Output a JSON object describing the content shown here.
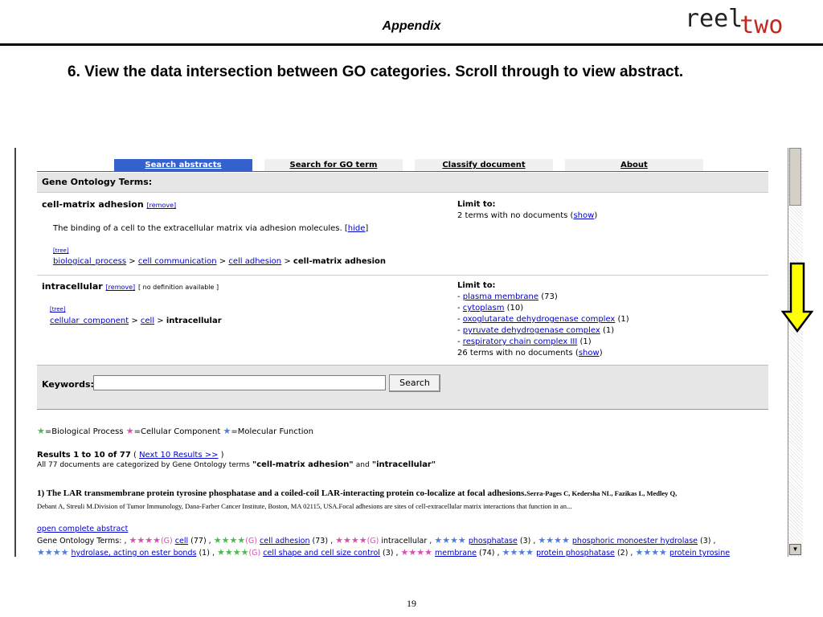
{
  "slide": {
    "title": "Appendix",
    "logo_reel": "reel",
    "logo_two": "two",
    "instruction": "6. View the data intersection between GO categories.  Scroll through to view abstract.",
    "page_number": "19"
  },
  "tabs": [
    {
      "label": "Search abstracts",
      "active": true
    },
    {
      "label": "Search for GO term",
      "active": false
    },
    {
      "label": "Classify document",
      "active": false
    },
    {
      "label": "About",
      "active": false
    }
  ],
  "panel": {
    "heading": "Gene Ontology Terms:",
    "term1": {
      "name": "cell-matrix adhesion",
      "remove": "[remove]",
      "definition_text": "The binding of a cell to the extracellular matrix via adhesion molecules. [",
      "hide": "hide",
      "definition_end": "]",
      "tree": "[tree]",
      "path": [
        "biological_process",
        "cell communication",
        "cell adhesion"
      ],
      "current": "cell-matrix adhesion",
      "limit_label": "Limit to:",
      "no_docs_text": "2 terms with no documents (",
      "show": "show",
      "no_docs_end": ")"
    },
    "term2": {
      "name": "intracellular",
      "remove": "[remove]",
      "no_def": "[ no definition available ]",
      "tree": "[tree]",
      "path": [
        "cellular_component",
        "cell"
      ],
      "current": "intracellular",
      "limit_label": "Limit to:",
      "limits": [
        {
          "label": "plasma membrane",
          "count": "(73)"
        },
        {
          "label": "cytoplasm",
          "count": "(10)"
        },
        {
          "label": "oxoglutarate dehydrogenase complex",
          "count": "(1)"
        },
        {
          "label": "pyruvate dehydrogenase complex",
          "count": "(1)"
        },
        {
          "label": "respiratory chain complex III",
          "count": "(1)"
        }
      ],
      "no_docs_text": "26 terms with no documents (",
      "show": "show",
      "no_docs_end": ")"
    }
  },
  "keywords": {
    "label": "Keywords:",
    "value": "",
    "button": "Search"
  },
  "legend": {
    "bio": "=Biological Process",
    "cell": "=Cellular Component",
    "mol": "=Molecular Function"
  },
  "results": {
    "summary": "Results 1 to 10 of 77",
    "next": "Next 10 Results >>",
    "categorized_prefix": "All 77 documents are categorized by Gene Ontology terms",
    "term_a": "\"cell-matrix adhesion\"",
    "and": "and",
    "term_b": "\"intracellular\"",
    "article_title": "1) The LAR transmembrane protein tyrosine phosphatase and a coiled-coil LAR-interacting protein co-localize at focal adhesions.",
    "article_authors": "Serra-Pages C, Kedersha NL, Fazikas L, Medley Q,",
    "article_meta": "Debant A, Streuli M.Division of Tumor Immunology, Dana-Farber Cancer Institute, Boston, MA 02115, USA.Focal adhesions are sites of cell-extracellular matrix interactions that function in an...",
    "open_abstract": "open complete abstract",
    "go_prefix": "Gene Ontology Terms: ,",
    "go_terms_line1": [
      {
        "label": "cell",
        "count": "(77) ,",
        "type": "cell"
      },
      {
        "label": "cell adhesion",
        "count": "(73) ,",
        "type": "bio"
      },
      {
        "label": "intracellular",
        "count": ",",
        "type": "cell-plain"
      },
      {
        "label": "phosphatase",
        "count": "(3) ,",
        "type": "mol"
      },
      {
        "label": "phosphoric monoester hydrolase",
        "count": "(3) ,",
        "type": "mol"
      }
    ],
    "go_terms_line2": [
      {
        "label": "hydrolase, acting on ester bonds",
        "count": "(1) ,",
        "type": "mol"
      },
      {
        "label": "cell shape and cell size control",
        "count": "(3) ,",
        "type": "bio"
      },
      {
        "label": "membrane",
        "count": "(74) ,",
        "type": "cell"
      },
      {
        "label": "protein phosphatase",
        "count": "(2) ,",
        "type": "mol"
      },
      {
        "label": "protein tyrosine",
        "count": "",
        "type": "mol"
      }
    ],
    "g_marker": "(G)"
  },
  "colors": {
    "tab_active": "#3461ce",
    "link": "#0000cc",
    "logo_accent": "#c0281e",
    "arrow_fill": "#ffff00"
  }
}
